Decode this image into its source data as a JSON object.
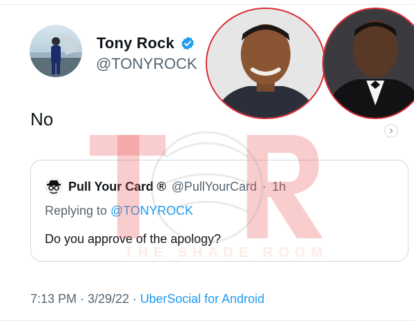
{
  "tweet": {
    "author": {
      "display_name": "Tony Rock",
      "handle": "@TONYROCK"
    },
    "text": "No",
    "timestamp": {
      "time": "7:13 PM",
      "date": "3/29/22",
      "source": "UberSocial for Android"
    }
  },
  "quoted": {
    "author": {
      "display_name": "Pull Your Card ®",
      "handle": "@PullYourCard",
      "age": "1h"
    },
    "replying_prefix": "Replying to",
    "replying_to": "@TONYROCK",
    "text": "Do you approve of the apology?"
  },
  "watermark": {
    "caption": "THE SHADE ROOM",
    "logo": "TSR"
  },
  "icons": {
    "verified": "verified-badge-icon",
    "chevron": "chevron-right-icon",
    "quoted_avatar": "spy-avatar-icon"
  },
  "colors": {
    "accent": "#1d9bf0",
    "secondary_text": "#536471",
    "photo_ring": "#d8262f",
    "watermark": "#e86e64"
  }
}
